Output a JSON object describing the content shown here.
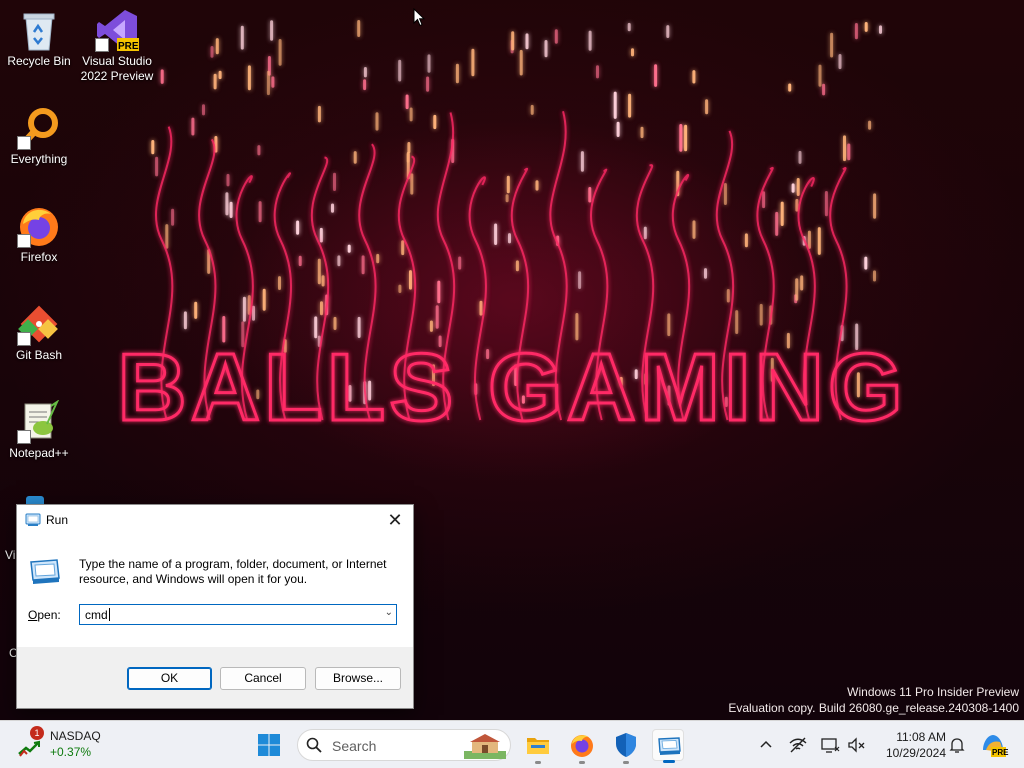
{
  "desktop": {
    "wallpaper_text": "BALLS GAMING",
    "watermark": {
      "line1": "Windows 11 Pro Insider Preview",
      "line2": "Evaluation copy. Build 26080.ge_release.240308-1400"
    },
    "icons": [
      {
        "label": "Recycle Bin",
        "icon": "recycle-bin-icon"
      },
      {
        "label": "Visual Studio 2022 Preview",
        "badge": "PRE",
        "icon": "visual-studio-icon"
      },
      {
        "label": "Everything",
        "icon": "everything-search-icon"
      },
      {
        "label": "Firefox",
        "icon": "firefox-icon"
      },
      {
        "label": "Git Bash",
        "icon": "git-bash-icon"
      },
      {
        "label": "Notepad++",
        "icon": "notepad-plus-plus-icon"
      }
    ],
    "partial_labels": [
      "Vi",
      "C"
    ]
  },
  "run_dialog": {
    "title": "Run",
    "close_glyph": "✕",
    "description": "Type the name of a program, folder, document, or Internet resource, and Windows will open it for you.",
    "open_label_underlined": "O",
    "open_label_rest": "pen:",
    "input_value": "cmd",
    "buttons": {
      "ok": "OK",
      "cancel": "Cancel",
      "browse": "Browse..."
    }
  },
  "taskbar": {
    "widget": {
      "name": "NASDAQ",
      "change": "+0.37%",
      "badge": "1",
      "change_color": "#0f7b0f"
    },
    "search_placeholder": "Search",
    "apps": [
      "start-icon",
      "file-explorer-icon",
      "firefox-icon",
      "windows-security-icon",
      "run-app-icon"
    ],
    "clock": {
      "time": "11:08 AM",
      "date": "10/29/2024"
    },
    "tray": [
      "chevron-up-icon",
      "network-icon",
      "display-icon",
      "sound-off-icon",
      "bell-icon",
      "copilot-icon"
    ],
    "copilot_badge": "PRE"
  },
  "colors": {
    "accent": "#0067c0",
    "wallpaper_neon": "#ff2a66",
    "spark": "#ffb37a"
  }
}
